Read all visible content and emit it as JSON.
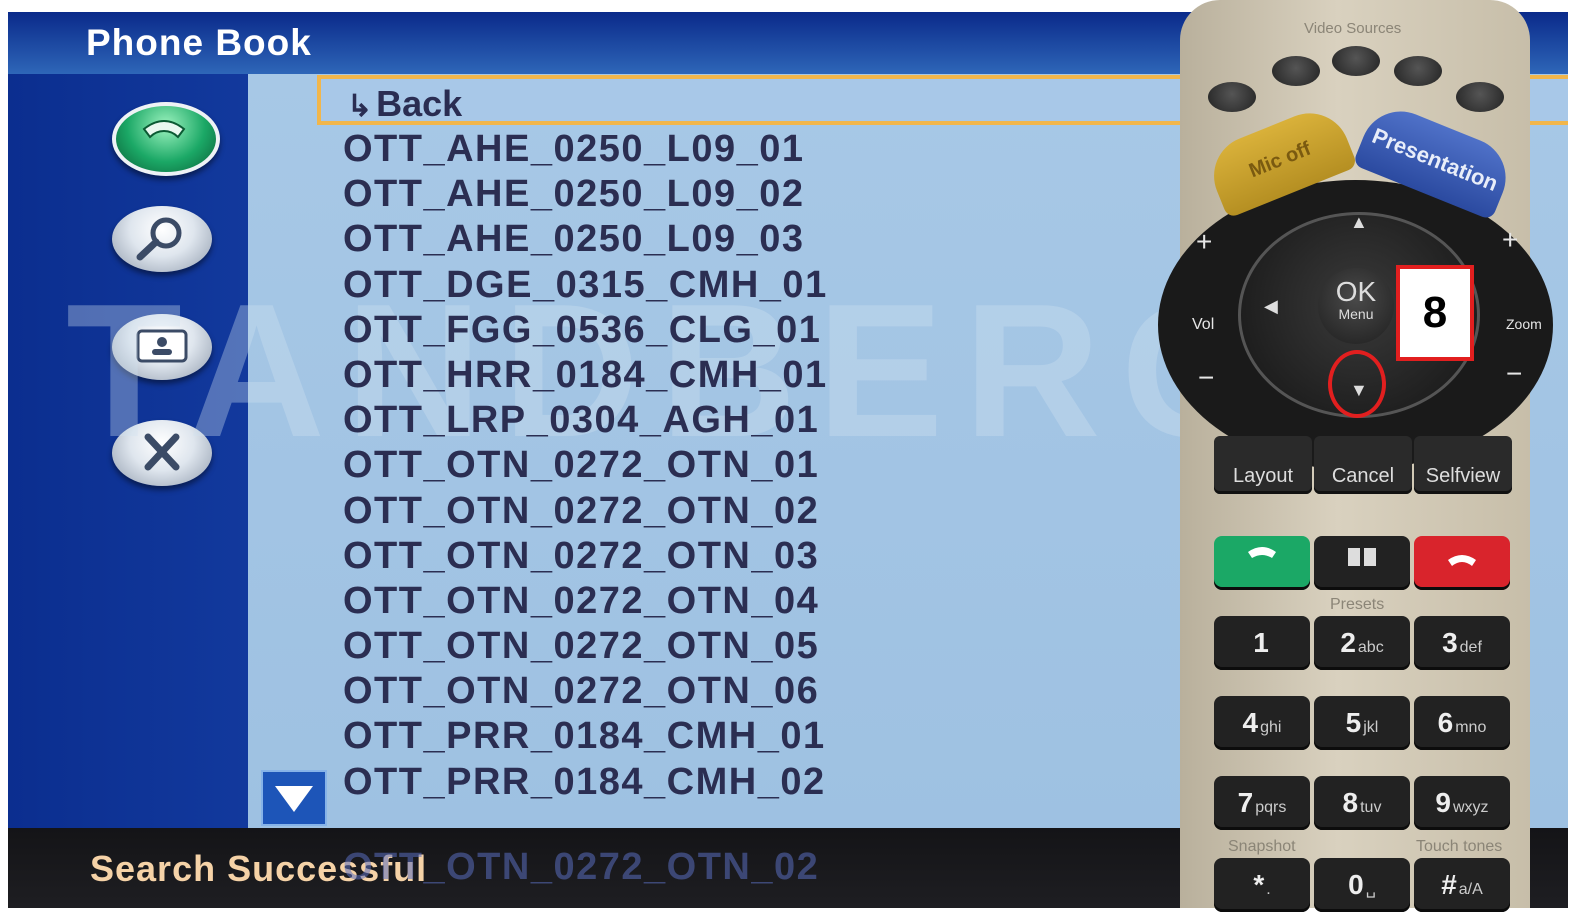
{
  "header": {
    "title": "Phone Book"
  },
  "watermark": "TANDBERG",
  "list": {
    "back_label": "Back",
    "back_arrow": "↳",
    "contacts": [
      "OTT_AHE_0250_L09_01",
      "OTT_AHE_0250_L09_02",
      "OTT_AHE_0250_L09_03",
      "OTT_DGE_0315_CMH_01",
      "OTT_FGG_0536_CLG_01",
      "OTT_HRR_0184_CMH_01",
      "OTT_LRP_0304_AGH_01",
      "OTT_OTN_0272_OTN_01",
      "OTT_OTN_0272_OTN_02",
      "OTT_OTN_0272_OTN_03",
      "OTT_OTN_0272_OTN_04",
      "OTT_OTN_0272_OTN_05",
      "OTT_OTN_0272_OTN_06",
      "OTT_PRR_0184_CMH_01",
      "OTT_PRR_0184_CMH_02"
    ],
    "ghost_row": "OTT_OTN_0272_OTN_02"
  },
  "status": {
    "text": "Search Successful"
  },
  "callout": {
    "number": "8"
  },
  "remote": {
    "video_sources_label": "Video Sources",
    "mic_label": "Mic off",
    "presentation_label": "Presentation",
    "ok_label": "OK",
    "menu_label": "Menu",
    "vol_label": "Vol",
    "zoom_label": "Zoom",
    "plus": "+",
    "minus": "−",
    "layout_label": "Layout",
    "cancel_label": "Cancel",
    "selfview_label": "Selfview",
    "presets_label": "Presets",
    "snapshot_label": "Snapshot",
    "touch_tones_label": "Touch tones",
    "keys": [
      {
        "num": "1",
        "sub": ""
      },
      {
        "num": "2",
        "sub": "abc"
      },
      {
        "num": "3",
        "sub": "def"
      },
      {
        "num": "4",
        "sub": "ghi"
      },
      {
        "num": "5",
        "sub": "jkl"
      },
      {
        "num": "6",
        "sub": "mno"
      },
      {
        "num": "7",
        "sub": "pqrs"
      },
      {
        "num": "8",
        "sub": "tuv"
      },
      {
        "num": "9",
        "sub": "wxyz"
      },
      {
        "num": "*",
        "sub": "."
      },
      {
        "num": "0",
        "sub": "␣"
      },
      {
        "num": "#",
        "sub": "a/A"
      }
    ]
  },
  "colors": {
    "highlight_border": "#f1b64b",
    "callout_red": "#e21f1f",
    "call_green": "#1ba866",
    "hangup_red": "#d9242c"
  }
}
